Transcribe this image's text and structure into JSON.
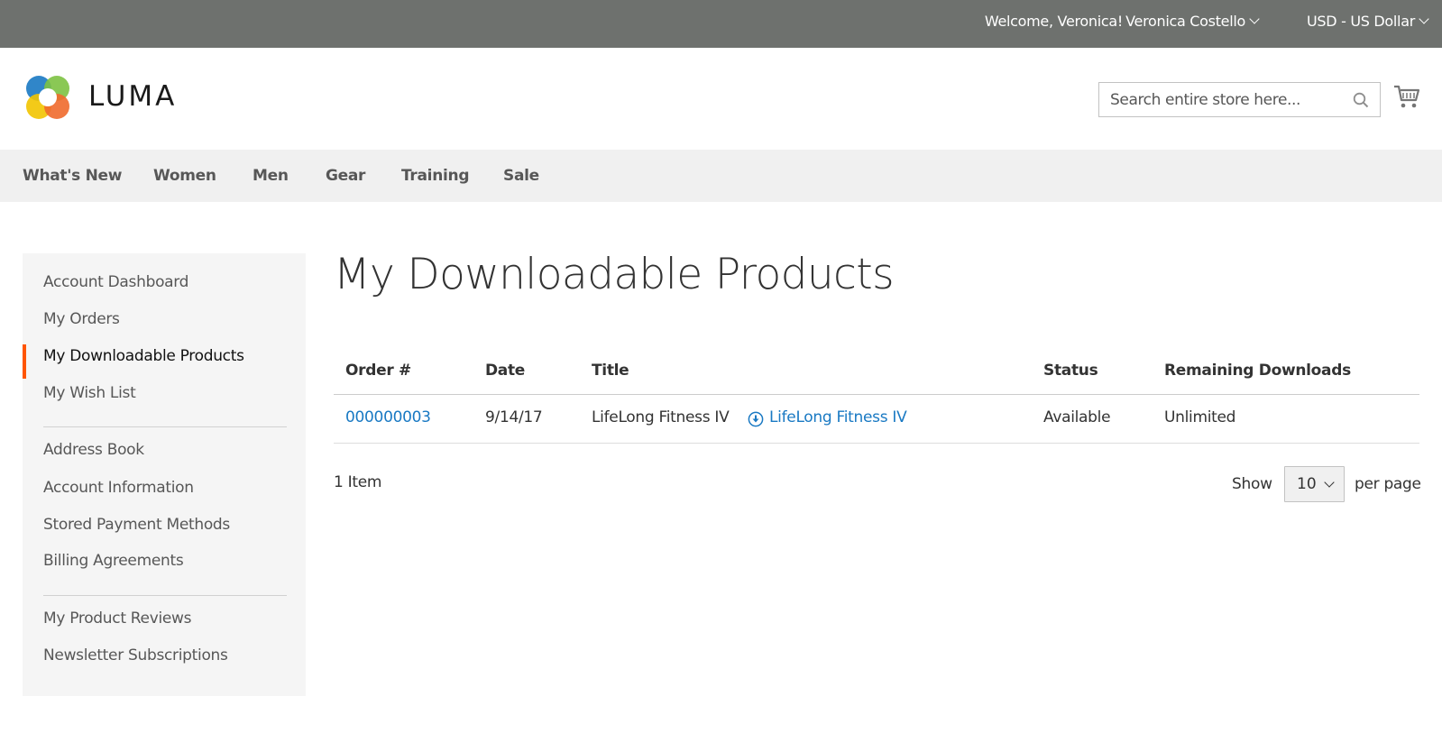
{
  "top_bar": {
    "welcome": "Welcome, Veronica!",
    "customer_name": "Veronica Costello",
    "currency": "USD - US Dollar"
  },
  "header": {
    "logo_text": "LUMA",
    "search_placeholder": "Search entire store here...",
    "icons": {
      "search": "search-icon",
      "cart": "cart-icon"
    }
  },
  "nav": {
    "items": [
      "What's New",
      "Women",
      "Men",
      "Gear",
      "Training",
      "Sale"
    ]
  },
  "sidebar": {
    "group1": [
      "Account Dashboard",
      "My Orders",
      "My Downloadable Products",
      "My Wish List"
    ],
    "group2": [
      "Address Book",
      "Account Information",
      "Stored Payment Methods",
      "Billing Agreements"
    ],
    "group3": [
      "My Product Reviews",
      "Newsletter Subscriptions"
    ],
    "current": "My Downloadable Products"
  },
  "main": {
    "title": "My Downloadable Products",
    "table": {
      "headers": [
        "Order #",
        "Date",
        "Title",
        "Status",
        "Remaining Downloads"
      ],
      "rows": [
        {
          "order": "000000003",
          "date": "9/14/17",
          "title": "LifeLong Fitness IV",
          "link": "LifeLong Fitness IV",
          "status": "Available",
          "remaining": "Unlimited"
        }
      ]
    },
    "toolbar": {
      "amount": "1 Item",
      "show_label": "Show",
      "limiter_value": "10",
      "per_page_label": "per page"
    }
  },
  "colors": {
    "top_bar_bg": "#6e716e",
    "nav_bg": "#f0f0f0",
    "sidebar_bg": "#f5f5f5",
    "link": "#1979c3",
    "active_marker": "#ff5501"
  }
}
